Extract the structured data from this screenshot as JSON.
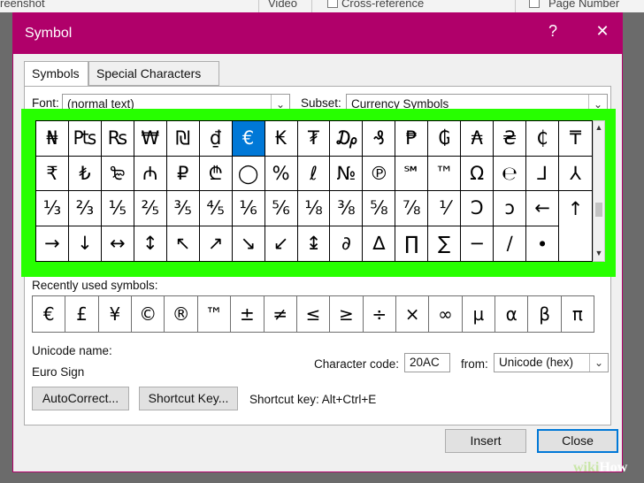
{
  "ribbon": {
    "left_text": "reenshot",
    "mid_text": "Video",
    "cross_text": "Cross-reference",
    "right_text": "Page Number"
  },
  "dialog": {
    "title": "Symbol",
    "help_glyph": "?",
    "close_glyph": "✕"
  },
  "tabs": [
    {
      "label": "Symbols",
      "active": true
    },
    {
      "label": "Special Characters",
      "active": false
    }
  ],
  "font": {
    "label": "Font:",
    "value": "(normal text)"
  },
  "subset": {
    "label": "Subset:",
    "value": "Currency Symbols"
  },
  "symbols": [
    "₦",
    "₧",
    "₨",
    "₩",
    "₪",
    "₫",
    "€",
    "₭",
    "₮",
    "₯",
    "₰",
    "₱",
    "₲",
    "₳",
    "₴",
    "₵",
    "₸",
    "₹",
    "₺",
    "₻",
    "₼",
    "₽",
    "₾",
    "◯",
    "%",
    "ℓ",
    "№",
    "℗",
    "℠",
    "™",
    "Ω",
    "℮",
    "⅃",
    "⅄",
    "⅓",
    "⅔",
    "⅕",
    "⅖",
    "⅗",
    "⅘",
    "⅙",
    "⅚",
    "⅛",
    "⅜",
    "⅝",
    "⅞",
    "⅟",
    "Ↄ",
    "ↄ",
    "←",
    "↑",
    "→",
    "↓",
    "↔",
    "↕",
    "↖",
    "↗",
    "↘",
    "↙",
    "↨",
    "∂",
    "∆",
    "∏",
    "∑",
    "−",
    "∕",
    "∙"
  ],
  "selected_symbol_index": 6,
  "recent": {
    "label": "Recently used symbols:",
    "items": [
      "€",
      "£",
      "¥",
      "©",
      "®",
      "™",
      "±",
      "≠",
      "≤",
      "≥",
      "÷",
      "×",
      "∞",
      "µ",
      "α",
      "β",
      "π"
    ]
  },
  "unicode": {
    "label": "Unicode name:",
    "name": "Euro Sign"
  },
  "char_code": {
    "label": "Character code:",
    "value": "20AC"
  },
  "from": {
    "label": "from:",
    "value": "Unicode (hex)"
  },
  "buttons": {
    "autocorrect": "AutoCorrect...",
    "shortcut_key": "Shortcut Key...",
    "insert": "Insert",
    "close": "Close"
  },
  "shortcut_text": "Shortcut key: Alt+Ctrl+E",
  "watermark": {
    "wiki": "wiki",
    "how": "How"
  },
  "colors": {
    "title_bar": "#b0006a",
    "highlight": "#27ff00",
    "selection": "#0078d7"
  }
}
